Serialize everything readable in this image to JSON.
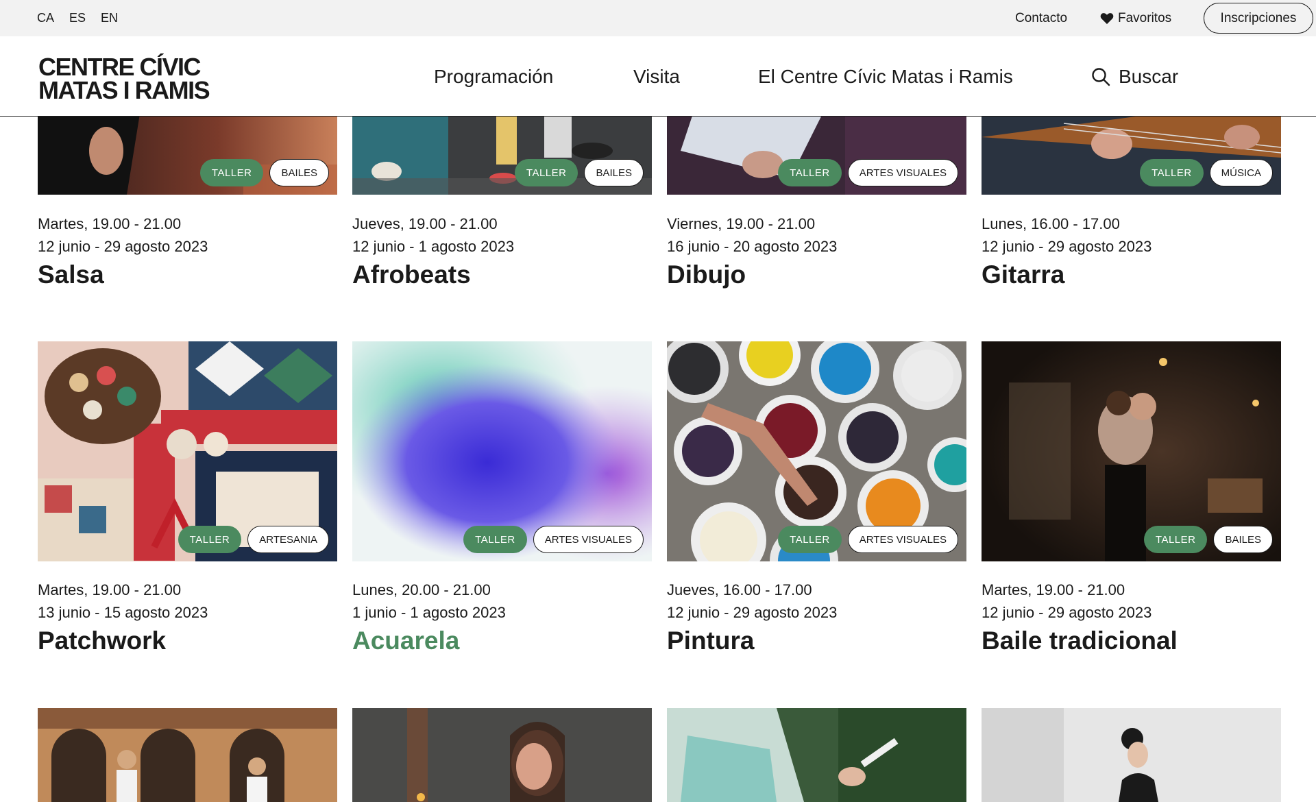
{
  "languages": [
    "CA",
    "ES",
    "EN"
  ],
  "utility": {
    "contact": "Contacto",
    "favorites": "Favoritos",
    "register": "Inscripciones"
  },
  "logo": {
    "line1": "CENTRE CÍVIC",
    "line2": "MATAS I RAMIS"
  },
  "nav": {
    "programacion": "Programación",
    "visita": "Visita",
    "centre": "El Centre Cívic Matas i Ramis",
    "search": "Buscar"
  },
  "colors": {
    "accent": "#4b8a5f",
    "text": "#1a1a1a",
    "topbar": "#f2f2f2"
  },
  "cards": [
    {
      "type": "TALLER",
      "category": "BAILES",
      "schedule": "Martes, 19.00 - 21.00",
      "dates": "12 junio - 29 agosto 2023",
      "title": "Salsa"
    },
    {
      "type": "TALLER",
      "category": "BAILES",
      "schedule": "Jueves, 19.00 - 21.00",
      "dates": "12 junio - 1 agosto 2023",
      "title": "Afrobeats"
    },
    {
      "type": "TALLER",
      "category": "ARTES VISUALES",
      "schedule": "Viernes, 19.00 - 21.00",
      "dates": "16 junio - 20 agosto 2023",
      "title": "Dibujo"
    },
    {
      "type": "TALLER",
      "category": "MÚSICA",
      "schedule": "Lunes, 16.00 - 17.00",
      "dates": "12 junio - 29 agosto 2023",
      "title": "Gitarra"
    },
    {
      "type": "TALLER",
      "category": "ARTESANIA",
      "schedule": "Martes, 19.00 - 21.00",
      "dates": "13 junio - 15 agosto 2023",
      "title": "Patchwork"
    },
    {
      "type": "TALLER",
      "category": "ARTES VISUALES",
      "schedule": "Lunes, 20.00 - 21.00",
      "dates": "1 junio - 1 agosto 2023",
      "title": "Acuarela"
    },
    {
      "type": "TALLER",
      "category": "ARTES VISUALES",
      "schedule": "Jueves, 16.00 - 17.00",
      "dates": "12 junio - 29 agosto 2023",
      "title": "Pintura"
    },
    {
      "type": "TALLER",
      "category": "BAILES",
      "schedule": "Martes, 19.00 - 21.00",
      "dates": "12 junio - 29 agosto 2023",
      "title": "Baile tradicional"
    }
  ]
}
